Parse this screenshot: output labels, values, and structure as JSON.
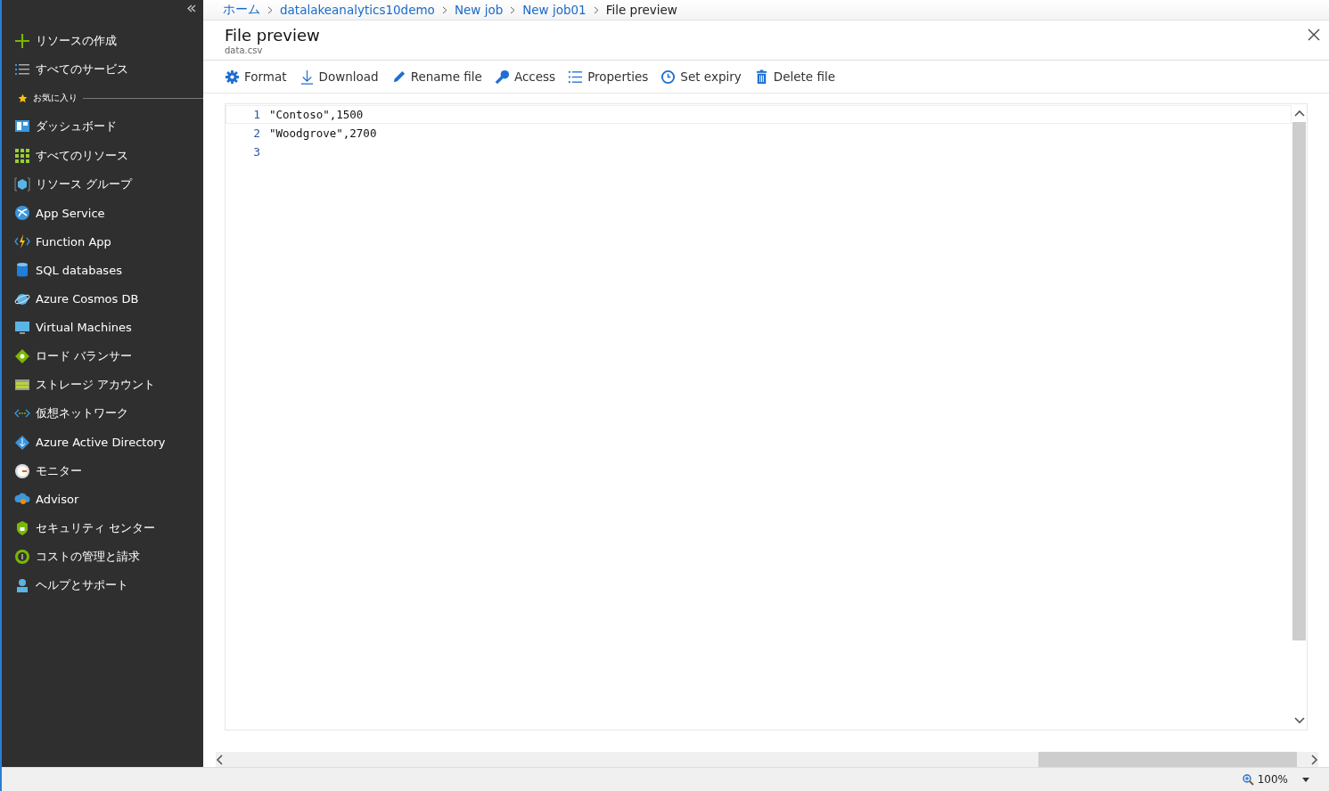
{
  "sidebar": {
    "create": "リソースの作成",
    "all_services": "すべてのサービス",
    "favorites_label": "お気に入り",
    "items": [
      {
        "label": "ダッシュボード"
      },
      {
        "label": "すべてのリソース"
      },
      {
        "label": "リソース グループ"
      },
      {
        "label": "App Service"
      },
      {
        "label": "Function App"
      },
      {
        "label": "SQL databases"
      },
      {
        "label": "Azure Cosmos DB"
      },
      {
        "label": "Virtual Machines"
      },
      {
        "label": "ロード バランサー"
      },
      {
        "label": "ストレージ アカウント"
      },
      {
        "label": "仮想ネットワーク"
      },
      {
        "label": "Azure Active Directory"
      },
      {
        "label": "モニター"
      },
      {
        "label": "Advisor"
      },
      {
        "label": "セキュリティ センター"
      },
      {
        "label": "コストの管理と請求"
      },
      {
        "label": "ヘルプとサポート"
      }
    ]
  },
  "breadcrumb": [
    {
      "label": "ホーム",
      "link": true
    },
    {
      "label": "datalakeanalytics10demo",
      "link": true
    },
    {
      "label": "New job",
      "link": true
    },
    {
      "label": "New job01",
      "link": true
    },
    {
      "label": "File preview",
      "link": false
    }
  ],
  "blade": {
    "title": "File preview",
    "subtitle": "data.csv"
  },
  "toolbar": [
    {
      "label": "Format"
    },
    {
      "label": "Download"
    },
    {
      "label": "Rename file"
    },
    {
      "label": "Access"
    },
    {
      "label": "Properties"
    },
    {
      "label": "Set expiry"
    },
    {
      "label": "Delete file"
    }
  ],
  "editor": {
    "lines": [
      {
        "number": "1",
        "text": "\"Contoso\",1500",
        "selected": true
      },
      {
        "number": "2",
        "text": "\"Woodgrove\",2700",
        "selected": false
      },
      {
        "number": "3",
        "selected": false
      }
    ]
  },
  "status_bar": {
    "zoom": "100%"
  }
}
